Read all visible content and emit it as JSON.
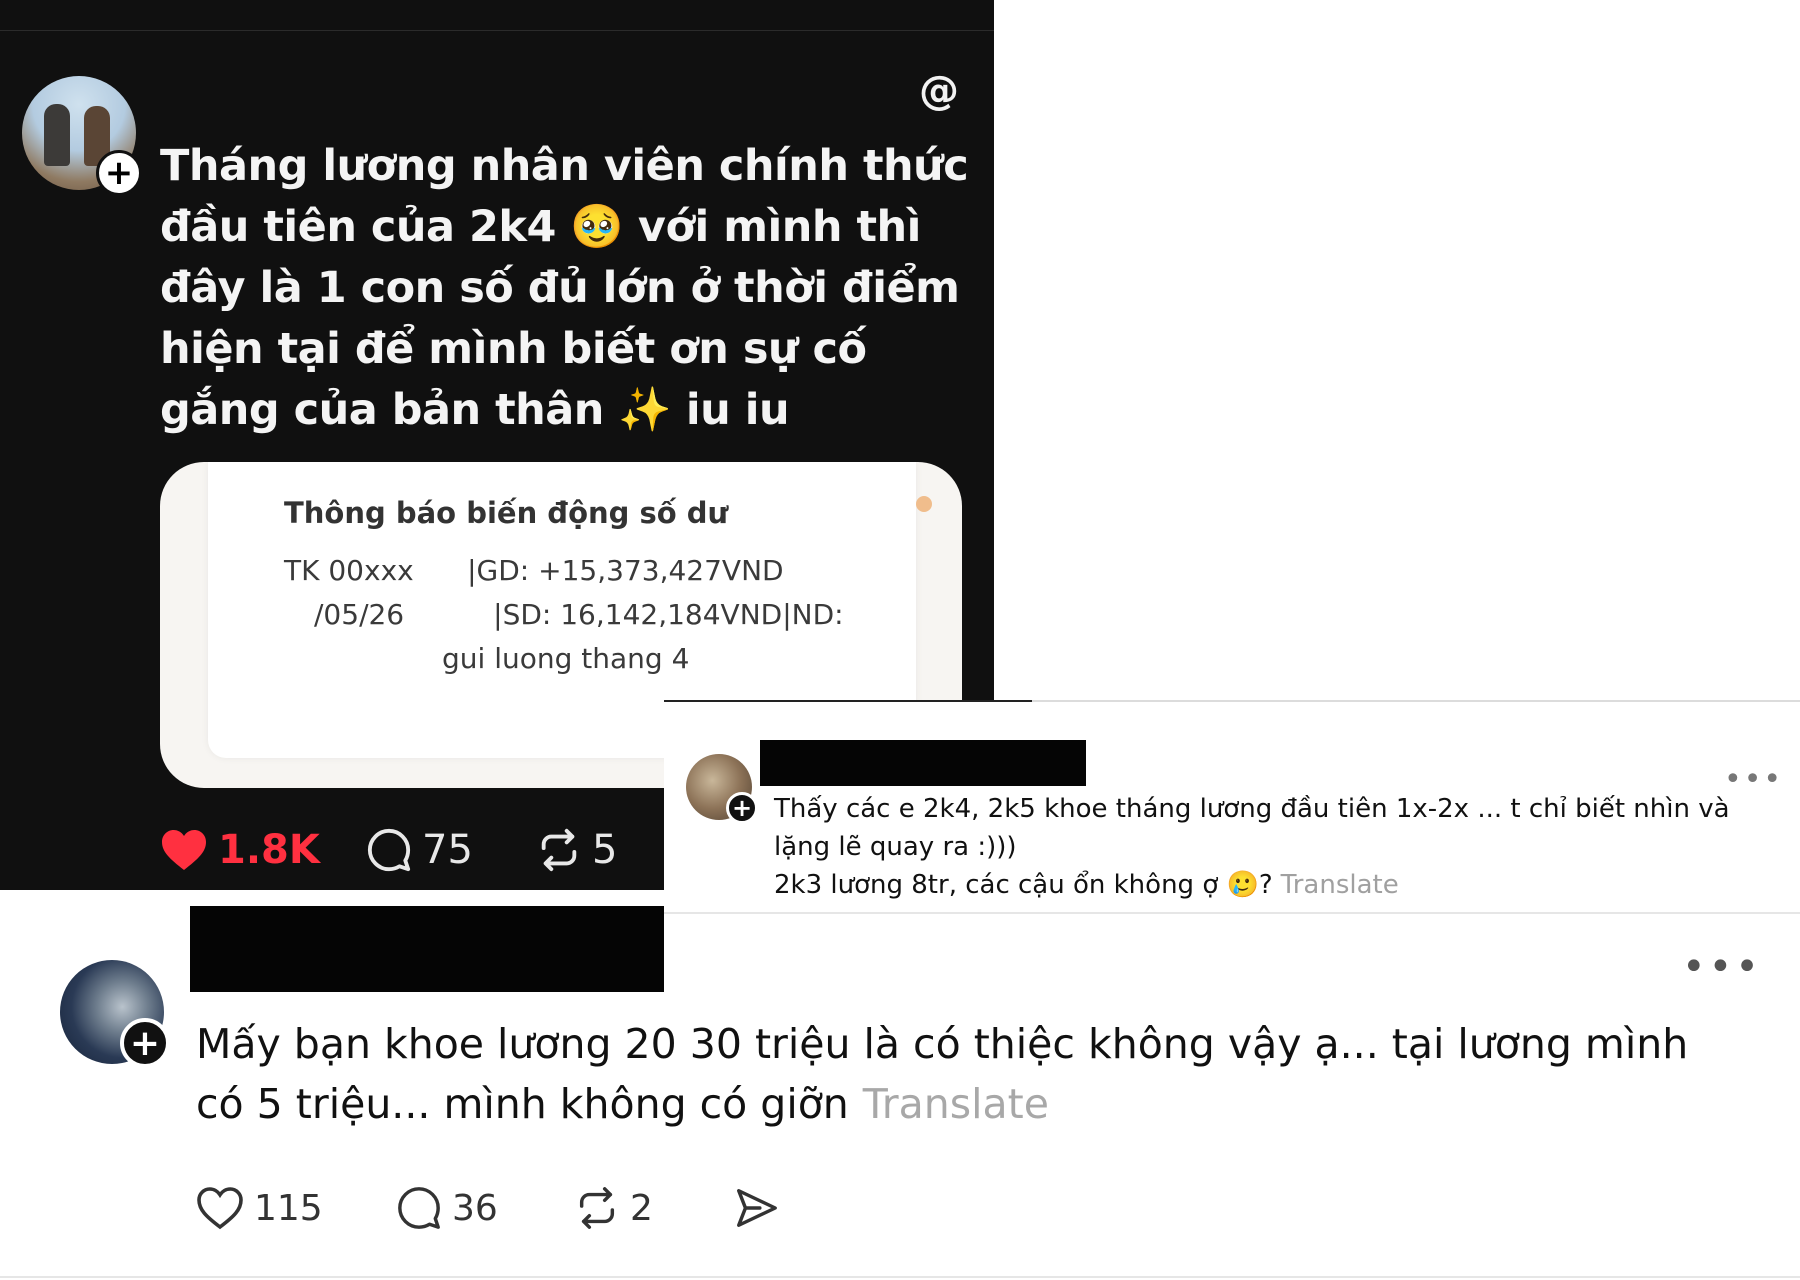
{
  "post1": {
    "text": "Tháng lương nhân viên chính thức đầu tiên của 2k4 🥹 với mình thì đây là 1 con số đủ lớn ở thời điểm hiện tại để mình biết ơn sự cố gắng của bản thân ✨ iu iu",
    "bank_card": {
      "title": "Thông báo biến động số dư",
      "line1": "TK 00xxx      |GD: +15,373,427VND",
      "line2": "/05/26          |SD: 16,142,184VND|ND:",
      "line3": "gui luong thang 4"
    },
    "actions": {
      "likes": "1.8K",
      "comments": "75",
      "reposts": "5"
    },
    "colors": {
      "like_color": "#ff3040",
      "background": "#101010"
    },
    "icons": {
      "logo": "threads-logo-icon"
    }
  },
  "post2": {
    "text": "Thấy các e 2k4, 2k5 khoe tháng lương đầu tiên 1x-2x ... t chỉ biết nhìn và lặng lẽ quay ra :)))\n2k3 lương 8tr, các cậu ổn không ợ 🥲?",
    "translate_label": "Translate",
    "more_label": "•••"
  },
  "post3": {
    "text": "Mấy bạn khoe lương 20 30 triệu là có thiệc không vậy ạ... tại lương mình có 5 triệu... mình không có giỡn",
    "translate_label": "Translate",
    "more_label": "•••",
    "actions": {
      "likes": "115",
      "comments": "36",
      "reposts": "2"
    }
  }
}
